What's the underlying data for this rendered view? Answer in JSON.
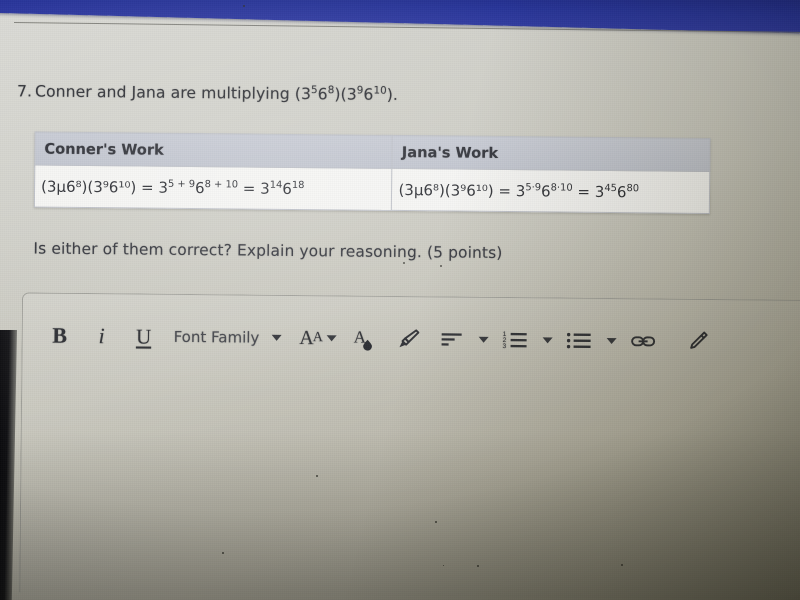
{
  "document": {
    "question_number": "7.",
    "question_text_before": "Conner and Jana are multiplying (3",
    "question_full": "7. Conner and Jana are multiplying (3µ6⁸)(3⁹6¹⁰).",
    "follow_up": "Is either of them correct? Explain your reasoning. (5 points)"
  },
  "question_expression": {
    "open_paren": "(",
    "base1": "3",
    "exp1": "5",
    "base2": "6",
    "exp2": "8",
    "close_paren": ")",
    "open_paren2": "(",
    "base3": "3",
    "exp3": "9",
    "base4": "6",
    "exp4": "10",
    "close_paren2": ")",
    "period": "."
  },
  "table": {
    "headers": [
      "Conner's Work",
      "Jana's Work"
    ],
    "rows": [
      {
        "owner": "Conner's Work",
        "expression_plain": "(3µ6⁸)(3⁹6¹⁰) = 3⁵⁺⁹6⁸⁺¹⁰ = 3¹⁴6¹⁸",
        "lhs": "(3µ6⁸)(3⁹6¹⁰)",
        "equals": "=",
        "step1_base_a": "3",
        "step1_exp_a": "5 + 9",
        "step1_base_b": "6",
        "step1_exp_b": "8 + 10",
        "equals2": "=",
        "result_base_a": "3",
        "result_exp_a": "14",
        "result_base_b": "6",
        "result_exp_b": "18",
        "method": "add-exponents"
      },
      {
        "owner": "Jana's Work",
        "expression_plain": "(3µ6⁸)(3⁹6¹⁰) = 3⁵·⁹6⁸·¹⁰ = 3⁴⁵6⁸⁰",
        "lhs": "(3µ6⁸)(3⁹6¹⁰)",
        "equals": "=",
        "step1_base_a": "3",
        "step1_exp_a": "5·9",
        "step1_base_b": "6",
        "step1_exp_b": "8·10",
        "equals2": "=",
        "result_base_a": "3",
        "result_exp_a": "45",
        "result_base_b": "6",
        "result_exp_b": "80",
        "method": "multiply-exponents"
      }
    ]
  },
  "editor": {
    "toolbar": {
      "bold_label": "B",
      "italic_label": "i",
      "underline_label": "U",
      "font_family_label": "Font Family",
      "font_size_label_big": "A",
      "font_size_label_small": "A",
      "items": [
        {
          "name": "bold-button",
          "label": "B"
        },
        {
          "name": "italic-button",
          "label": "i"
        },
        {
          "name": "underline-button",
          "label": "U"
        },
        {
          "name": "font-family-dropdown",
          "label": "Font Family"
        },
        {
          "name": "font-size-dropdown",
          "label": "AA"
        },
        {
          "name": "text-color-button",
          "label": ""
        },
        {
          "name": "highlighter-button",
          "label": ""
        },
        {
          "name": "text-align-dropdown",
          "label": ""
        },
        {
          "name": "numbered-list-dropdown",
          "label": ""
        },
        {
          "name": "bullet-list-dropdown",
          "label": ""
        },
        {
          "name": "insert-link-button",
          "label": ""
        },
        {
          "name": "attachment-button",
          "label": ""
        }
      ]
    },
    "body_text": ""
  },
  "colors": {
    "window_chrome": "#1c2a93",
    "table_header_bg": "#bfc3ce",
    "table_cell_bg": "#f4f4f2",
    "text": "#23252b",
    "page_bg": "#cfcfc8"
  }
}
